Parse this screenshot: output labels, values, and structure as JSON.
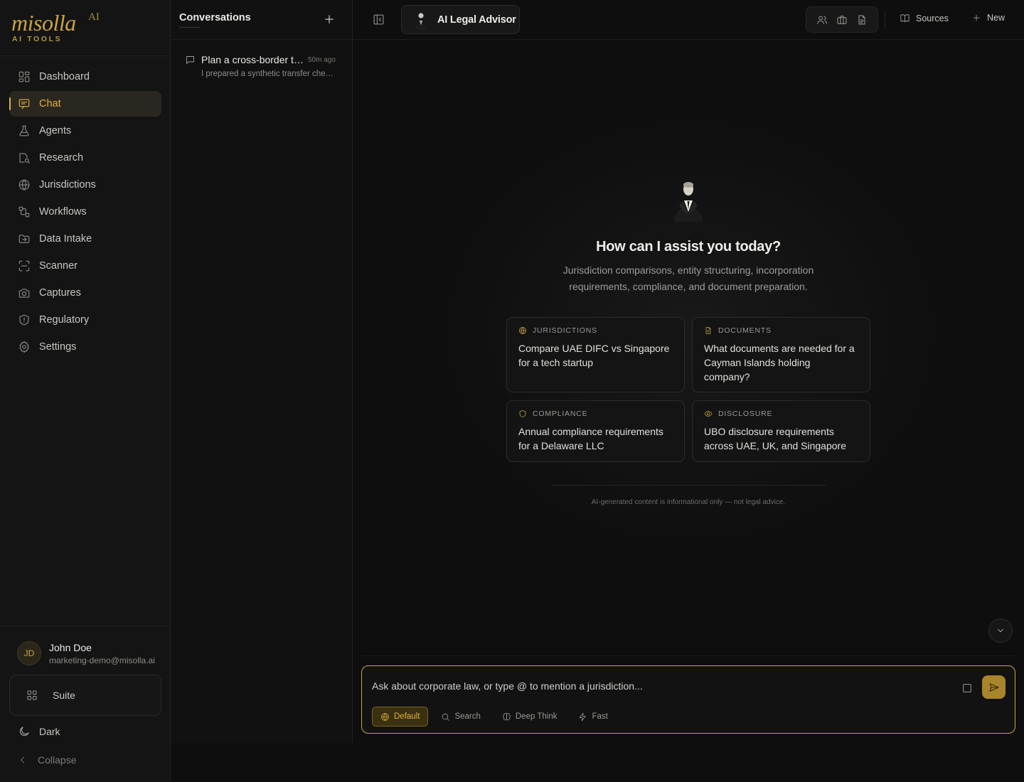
{
  "brand": {
    "name": "misolla",
    "superscript": "AI",
    "tagline": "AI TOOLS"
  },
  "sidebar": {
    "items": [
      {
        "label": "Dashboard",
        "icon": "dashboard-icon"
      },
      {
        "label": "Chat",
        "icon": "chat-icon",
        "active": true
      },
      {
        "label": "Agents",
        "icon": "flask-icon"
      },
      {
        "label": "Research",
        "icon": "research-icon"
      },
      {
        "label": "Jurisdictions",
        "icon": "globe-icon"
      },
      {
        "label": "Workflows",
        "icon": "workflow-icon"
      },
      {
        "label": "Data Intake",
        "icon": "folder-import-icon"
      },
      {
        "label": "Scanner",
        "icon": "scan-icon"
      },
      {
        "label": "Captures",
        "icon": "camera-icon"
      },
      {
        "label": "Regulatory",
        "icon": "shield-icon"
      },
      {
        "label": "Settings",
        "icon": "gear-icon"
      }
    ],
    "user": {
      "initials": "JD",
      "name": "John Doe",
      "email": "marketing-demo@misolla.ai"
    },
    "suite_label": "Suite",
    "theme_label": "Dark",
    "collapse_label": "Collapse"
  },
  "conversations": {
    "title": "Conversations",
    "items": [
      {
        "title": "Plan a cross-border transfer",
        "time": "50m ago",
        "snippet": "I prepared a synthetic transfer checklist"
      }
    ]
  },
  "header": {
    "agent_name": "AI Legal Advisor",
    "sources_label": "Sources",
    "new_label": "New"
  },
  "welcome": {
    "title": "How can I assist you today?",
    "subtitle": "Jurisdiction comparisons, entity structuring, incorporation requirements, compliance, and document preparation.",
    "cards": [
      {
        "category": "JURISDICTIONS",
        "icon": "globe-icon",
        "text": "Compare UAE DIFC vs Singapore for a tech startup"
      },
      {
        "category": "DOCUMENTS",
        "icon": "document-icon",
        "text": "What documents are needed for a Cayman Islands holding company?"
      },
      {
        "category": "COMPLIANCE",
        "icon": "shield-icon",
        "text": "Annual compliance requirements for a Delaware LLC"
      },
      {
        "category": "DISCLOSURE",
        "icon": "eye-icon",
        "text": "UBO disclosure requirements across UAE, UK, and Singapore"
      }
    ],
    "disclaimer": "AI-generated content is informational only — not legal advice."
  },
  "composer": {
    "placeholder": "Ask about corporate law, or type @ to mention a jurisdiction...",
    "value": "",
    "modes": [
      {
        "label": "Default",
        "icon": "globe-icon",
        "active": true
      },
      {
        "label": "Search",
        "icon": "search-icon"
      },
      {
        "label": "Deep Think",
        "icon": "brain-icon"
      },
      {
        "label": "Fast",
        "icon": "bolt-icon"
      }
    ]
  },
  "colors": {
    "accent": "#e0b23a",
    "background": "#0e0e0e",
    "sidebar": "#141414"
  }
}
